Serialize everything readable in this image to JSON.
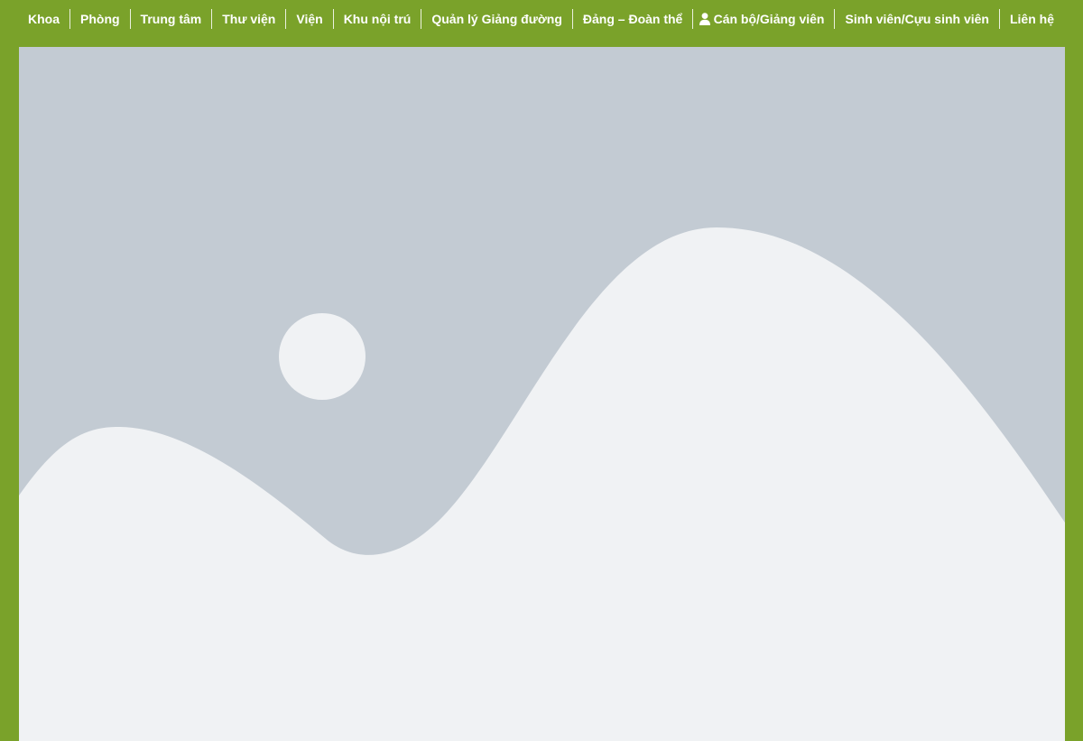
{
  "nav": {
    "left_items": [
      {
        "label": "Khoa"
      },
      {
        "label": "Phòng"
      },
      {
        "label": "Trung tâm"
      },
      {
        "label": "Thư viện"
      },
      {
        "label": "Viện"
      },
      {
        "label": "Khu nội trú"
      },
      {
        "label": "Quản lý Giảng đường"
      },
      {
        "label": "Đảng – Đoàn thể"
      }
    ],
    "right_items": [
      {
        "label": "Cán bộ/Giảng viên",
        "icon": "user-icon"
      },
      {
        "label": "Sinh viên/Cựu sinh viên"
      },
      {
        "label": "Liên hệ"
      }
    ]
  },
  "hero": {
    "type": "image-placeholder",
    "background_color": "#c3cbd3",
    "shape_color": "#f0f2f4"
  },
  "colors": {
    "accent": "#7aa22a",
    "nav_text": "#ffffff"
  }
}
